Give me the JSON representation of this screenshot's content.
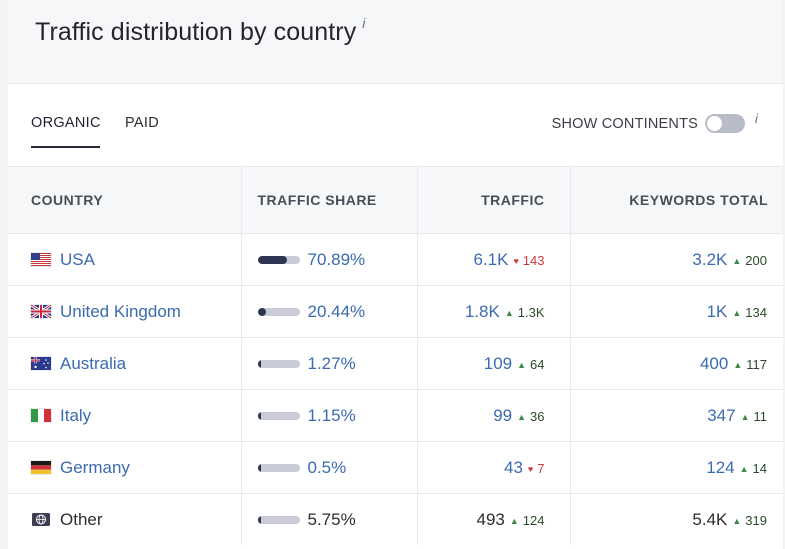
{
  "header": {
    "title": "Traffic distribution by country",
    "info": "i"
  },
  "tabs": [
    {
      "label": "ORGANIC",
      "active": true
    },
    {
      "label": "PAID",
      "active": false
    }
  ],
  "show_continents": {
    "label": "SHOW CONTINENTS",
    "enabled": false,
    "info": "i"
  },
  "table": {
    "columns": [
      "COUNTRY",
      "TRAFFIC SHARE",
      "TRAFFIC",
      "KEYWORDS TOTAL"
    ],
    "rows": [
      {
        "country": "USA",
        "flag": "us-flag-icon",
        "share": "70.89%",
        "share_value": 70.89,
        "traffic": "6.1K",
        "traffic_delta": "143",
        "traffic_dir": "down",
        "keywords": "3.2K",
        "keywords_delta": "200",
        "keywords_dir": "up",
        "link": true
      },
      {
        "country": "United Kingdom",
        "flag": "uk-flag-icon",
        "share": "20.44%",
        "share_value": 20.44,
        "traffic": "1.8K",
        "traffic_delta": "1.3K",
        "traffic_dir": "up",
        "keywords": "1K",
        "keywords_delta": "134",
        "keywords_dir": "up",
        "link": true
      },
      {
        "country": "Australia",
        "flag": "australia-flag-icon",
        "share": "1.27%",
        "share_value": 1.27,
        "traffic": "109",
        "traffic_delta": "64",
        "traffic_dir": "up",
        "keywords": "400",
        "keywords_delta": "117",
        "keywords_dir": "up",
        "link": true
      },
      {
        "country": "Italy",
        "flag": "italy-flag-icon",
        "share": "1.15%",
        "share_value": 1.15,
        "traffic": "99",
        "traffic_delta": "36",
        "traffic_dir": "up",
        "keywords": "347",
        "keywords_delta": "11",
        "keywords_dir": "up",
        "link": true
      },
      {
        "country": "Germany",
        "flag": "germany-flag-icon",
        "share": "0.5%",
        "share_value": 0.5,
        "traffic": "43",
        "traffic_delta": "7",
        "traffic_dir": "down",
        "keywords": "124",
        "keywords_delta": "14",
        "keywords_dir": "up",
        "link": true
      },
      {
        "country": "Other",
        "flag": "globe-icon",
        "share": "5.75%",
        "share_value": 5.75,
        "traffic": "493",
        "traffic_delta": "124",
        "traffic_dir": "up",
        "keywords": "5.4K",
        "keywords_delta": "319",
        "keywords_dir": "up",
        "link": false
      }
    ]
  },
  "colors": {
    "link": "#3b6bb0",
    "up": "#3a8a4a",
    "down": "#d03a3a",
    "bar": "#2d3550",
    "bar_track": "#c9ccd8"
  }
}
